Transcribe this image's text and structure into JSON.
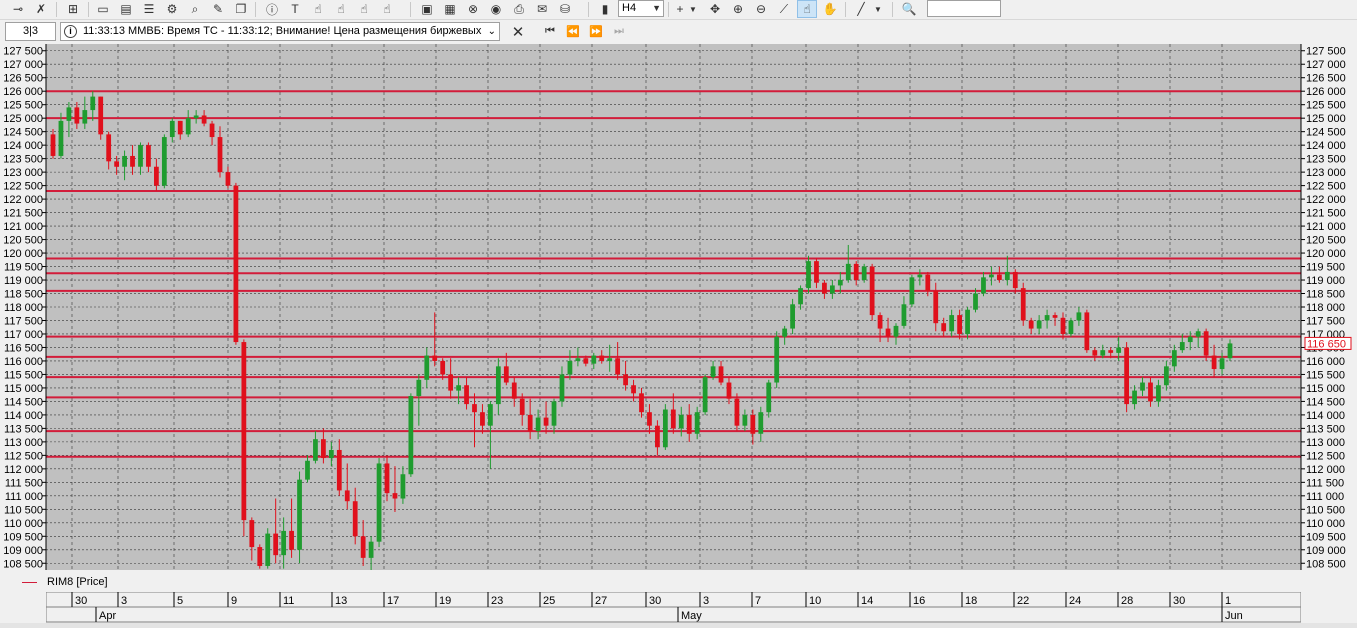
{
  "toolbar": {
    "timeframe": "H4",
    "search_placeholder": ""
  },
  "infobar": {
    "page_counter": "3|3",
    "message": "11:33:13  ММВБ: Время ТС - 11:33:12; Внимание! Цена размещения биржевых"
  },
  "legend": {
    "label": "RIM8 [Price]"
  },
  "colors": {
    "plot_bg": "#c0c0c0",
    "up": "#1f9c2f",
    "down": "#e0101c",
    "level_line": "#d21c3a",
    "grid": "#333333"
  },
  "chart_data": {
    "type": "candlestick",
    "instrument": "RIM8 [Price]",
    "timeframe": "H4",
    "last_price": "116 650",
    "ylim": [
      108250,
      127750
    ],
    "y_ticks": [
      108500,
      109000,
      109500,
      110000,
      110500,
      111000,
      111500,
      112000,
      112500,
      113000,
      113500,
      114000,
      114500,
      115000,
      115500,
      116000,
      116500,
      117000,
      117500,
      118000,
      118500,
      119000,
      119500,
      120000,
      120500,
      121000,
      121500,
      122000,
      122500,
      123000,
      123500,
      124000,
      124500,
      125000,
      125500,
      126000,
      126500,
      127000,
      127500
    ],
    "x_ticks": [
      "30",
      "3",
      "5",
      "9",
      "11",
      "13",
      "17",
      "19",
      "23",
      "25",
      "27",
      "30",
      "3",
      "7",
      "10",
      "14",
      "16",
      "18",
      "22",
      "24",
      "28",
      "30",
      "1"
    ],
    "month_labels": [
      "Apr",
      "May",
      "Jun"
    ],
    "level_lines": [
      126000,
      125000,
      122300,
      119800,
      119250,
      118600,
      116900,
      116150,
      115400,
      114650,
      113400,
      112450
    ],
    "candles": [
      [
        124400,
        124600,
        123500,
        123600
      ],
      [
        123600,
        125200,
        123500,
        124900
      ],
      [
        124900,
        125600,
        124300,
        125400
      ],
      [
        125400,
        125600,
        124600,
        124800
      ],
      [
        124800,
        125800,
        124600,
        125300
      ],
      [
        125300,
        126000,
        124900,
        125800
      ],
      [
        125800,
        125800,
        124200,
        124400
      ],
      [
        124400,
        124500,
        123100,
        123400
      ],
      [
        123400,
        123600,
        122900,
        123200
      ],
      [
        123200,
        123800,
        122700,
        123600
      ],
      [
        123600,
        124000,
        122900,
        123200
      ],
      [
        123200,
        124100,
        122900,
        124000
      ],
      [
        124000,
        124100,
        123000,
        123200
      ],
      [
        123200,
        123500,
        122300,
        122500
      ],
      [
        122500,
        124400,
        122400,
        124300
      ],
      [
        124300,
        125000,
        124100,
        124900
      ],
      [
        124900,
        124900,
        124200,
        124400
      ],
      [
        124400,
        125300,
        124300,
        125000
      ],
      [
        125000,
        125300,
        124800,
        125100
      ],
      [
        125100,
        125300,
        124700,
        124800
      ],
      [
        124800,
        124900,
        124000,
        124300
      ],
      [
        124300,
        124700,
        122800,
        123000
      ],
      [
        123000,
        123200,
        122400,
        122500
      ],
      [
        122500,
        122600,
        116600,
        116700
      ],
      [
        116700,
        116800,
        109500,
        110100
      ],
      [
        110100,
        110200,
        108600,
        109100
      ],
      [
        109100,
        109200,
        108300,
        108400
      ],
      [
        108400,
        109800,
        108300,
        109600
      ],
      [
        109600,
        110900,
        108500,
        108800
      ],
      [
        108800,
        110200,
        108300,
        109700
      ],
      [
        109700,
        110900,
        108700,
        109000
      ],
      [
        109000,
        111900,
        108500,
        111600
      ],
      [
        111600,
        112500,
        111500,
        112300
      ],
      [
        112300,
        113400,
        112200,
        113100
      ],
      [
        113100,
        113500,
        112200,
        112400
      ],
      [
        112400,
        113000,
        112100,
        112700
      ],
      [
        112700,
        113100,
        111000,
        111200
      ],
      [
        111200,
        112200,
        110500,
        110800
      ],
      [
        110800,
        111300,
        109200,
        109500
      ],
      [
        109500,
        110100,
        108400,
        108700
      ],
      [
        108700,
        109500,
        108200,
        109300
      ],
      [
        109300,
        112400,
        109100,
        112200
      ],
      [
        112200,
        112500,
        110800,
        111100
      ],
      [
        111100,
        112100,
        110400,
        110900
      ],
      [
        110900,
        112100,
        110700,
        111800
      ],
      [
        111800,
        114800,
        111700,
        114700
      ],
      [
        114700,
        115500,
        113600,
        115300
      ],
      [
        115300,
        116500,
        115000,
        116200
      ],
      [
        116200,
        117800,
        115800,
        116000
      ],
      [
        116000,
        116100,
        115300,
        115500
      ],
      [
        115500,
        116100,
        114600,
        114900
      ],
      [
        114900,
        115400,
        114400,
        115100
      ],
      [
        115100,
        115400,
        114200,
        114400
      ],
      [
        114400,
        114800,
        112800,
        114100
      ],
      [
        114100,
        114400,
        113300,
        113600
      ],
      [
        113600,
        114500,
        112000,
        114400
      ],
      [
        114400,
        116100,
        114000,
        115800
      ],
      [
        115800,
        116300,
        115100,
        115200
      ],
      [
        115200,
        115400,
        114300,
        114600
      ],
      [
        114600,
        114800,
        113600,
        114000
      ],
      [
        114000,
        114600,
        113100,
        113400
      ],
      [
        113400,
        114200,
        113100,
        113900
      ],
      [
        113900,
        114500,
        113300,
        113600
      ],
      [
        113600,
        114600,
        113300,
        114500
      ],
      [
        114500,
        115800,
        114300,
        115500
      ],
      [
        115500,
        116400,
        115300,
        116000
      ],
      [
        116000,
        116500,
        115800,
        116100
      ],
      [
        116100,
        116200,
        115800,
        115900
      ],
      [
        115900,
        116300,
        115700,
        116200
      ],
      [
        116200,
        116400,
        115900,
        116000
      ],
      [
        116000,
        116600,
        115600,
        116100
      ],
      [
        116100,
        116700,
        115300,
        115500
      ],
      [
        115500,
        116000,
        114900,
        115100
      ],
      [
        115100,
        115300,
        114500,
        114800
      ],
      [
        114800,
        115000,
        113900,
        114100
      ],
      [
        114100,
        114400,
        113300,
        113600
      ],
      [
        113600,
        113800,
        112500,
        112800
      ],
      [
        112800,
        114400,
        112700,
        114200
      ],
      [
        114200,
        114800,
        113300,
        113500
      ],
      [
        113500,
        114300,
        113200,
        114000
      ],
      [
        114000,
        114400,
        113000,
        113300
      ],
      [
        113300,
        114300,
        113100,
        114100
      ],
      [
        114100,
        115500,
        114000,
        115400
      ],
      [
        115400,
        116000,
        115300,
        115800
      ],
      [
        115800,
        116000,
        115100,
        115200
      ],
      [
        115200,
        115400,
        114400,
        114600
      ],
      [
        114600,
        114800,
        113400,
        113600
      ],
      [
        113600,
        114200,
        113400,
        114000
      ],
      [
        114000,
        114200,
        112900,
        113300
      ],
      [
        113300,
        114300,
        113000,
        114100
      ],
      [
        114100,
        115300,
        113900,
        115200
      ],
      [
        115200,
        117100,
        115000,
        116900
      ],
      [
        116900,
        117300,
        116600,
        117200
      ],
      [
        117200,
        118300,
        117000,
        118100
      ],
      [
        118100,
        118800,
        117900,
        118700
      ],
      [
        118700,
        119900,
        118500,
        119700
      ],
      [
        119700,
        119800,
        118700,
        118900
      ],
      [
        118900,
        119000,
        118300,
        118500
      ],
      [
        118500,
        119000,
        118300,
        118800
      ],
      [
        118800,
        119300,
        118500,
        119000
      ],
      [
        119000,
        120300,
        118900,
        119600
      ],
      [
        119600,
        119700,
        118800,
        119000
      ],
      [
        119000,
        119600,
        118900,
        119500
      ],
      [
        119500,
        119600,
        117500,
        117700
      ],
      [
        117700,
        117800,
        116700,
        117200
      ],
      [
        117200,
        117600,
        116700,
        116900
      ],
      [
        116900,
        117400,
        116600,
        117300
      ],
      [
        117300,
        118400,
        117200,
        118100
      ],
      [
        118100,
        119200,
        118000,
        119100
      ],
      [
        119100,
        119400,
        118800,
        119200
      ],
      [
        119200,
        119300,
        118400,
        118600
      ],
      [
        118600,
        118900,
        117100,
        117400
      ],
      [
        117400,
        117600,
        116900,
        117100
      ],
      [
        117100,
        117900,
        116900,
        117700
      ],
      [
        117700,
        117900,
        116800,
        117000
      ],
      [
        117000,
        118000,
        116800,
        117900
      ],
      [
        117900,
        118700,
        117800,
        118500
      ],
      [
        118500,
        119300,
        118400,
        119100
      ],
      [
        119100,
        119500,
        118800,
        119200
      ],
      [
        119200,
        119500,
        118900,
        119000
      ],
      [
        119000,
        119900,
        118800,
        119300
      ],
      [
        119300,
        119400,
        118500,
        118700
      ],
      [
        118700,
        118900,
        117300,
        117500
      ],
      [
        117500,
        117600,
        117000,
        117200
      ],
      [
        117200,
        117700,
        117000,
        117500
      ],
      [
        117500,
        117900,
        117200,
        117700
      ],
      [
        117700,
        117800,
        117300,
        117600
      ],
      [
        117600,
        117800,
        116800,
        117000
      ],
      [
        117000,
        117600,
        116900,
        117500
      ],
      [
        117500,
        118000,
        117300,
        117800
      ],
      [
        117800,
        117900,
        116300,
        116400
      ],
      [
        116400,
        116500,
        116000,
        116200
      ],
      [
        116200,
        116600,
        116100,
        116400
      ],
      [
        116400,
        116500,
        116100,
        116300
      ],
      [
        116300,
        116900,
        116000,
        116500
      ],
      [
        116500,
        116700,
        114100,
        114400
      ],
      [
        114400,
        115100,
        114200,
        114900
      ],
      [
        114900,
        115400,
        114700,
        115200
      ],
      [
        115200,
        115400,
        114300,
        114500
      ],
      [
        114500,
        115300,
        114300,
        115100
      ],
      [
        115100,
        116000,
        114900,
        115800
      ],
      [
        115800,
        116600,
        115600,
        116400
      ],
      [
        116400,
        117000,
        116300,
        116700
      ],
      [
        116700,
        117100,
        116400,
        116900
      ],
      [
        116900,
        117200,
        116500,
        117100
      ],
      [
        117100,
        117200,
        116000,
        116200
      ],
      [
        116200,
        116600,
        115400,
        115700
      ],
      [
        115700,
        116300,
        115500,
        116100
      ],
      [
        116100,
        116800,
        116000,
        116650
      ]
    ]
  }
}
